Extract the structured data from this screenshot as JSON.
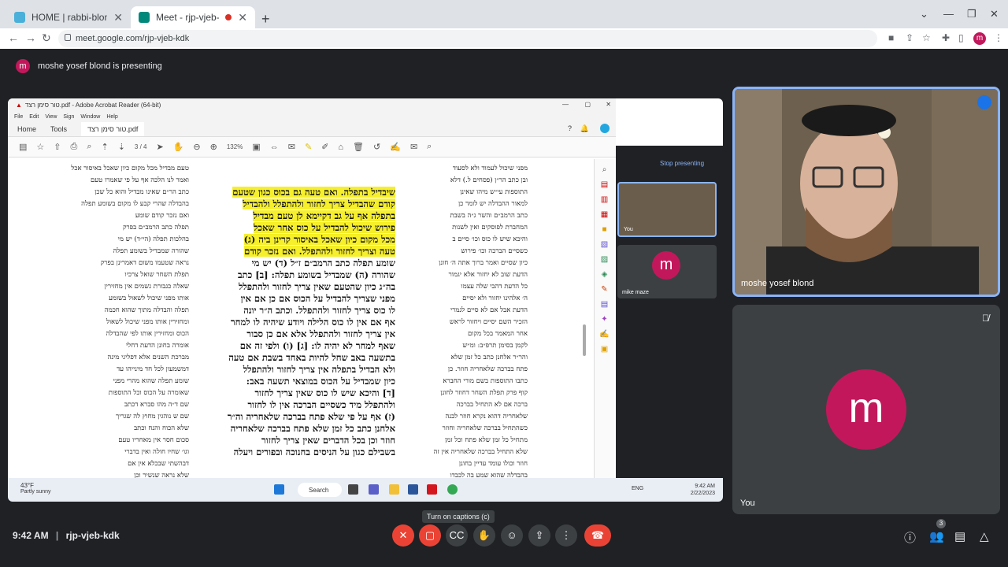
{
  "browser": {
    "tabs": [
      {
        "title": "HOME | rabbi-blond",
        "active": false
      },
      {
        "title": "Meet - rjp-vjeb-kdk",
        "active": true,
        "recording": true
      }
    ],
    "url": "meet.google.com/rjp-vjeb-kdk",
    "profile_initial": "m"
  },
  "meet": {
    "presenting_banner": "moshe yosef blond is presenting",
    "presenter_initial": "m",
    "meeting_code": "rjp-vjeb-kdk",
    "time": "9:42 AM",
    "participants_count": "3",
    "tooltip": "Turn on captions (c)",
    "tiles": [
      {
        "name": "moshe yosef blond",
        "speaking": true
      },
      {
        "name": "You",
        "initial": "m"
      }
    ],
    "colors": {
      "accent": "#8ab4f8",
      "end_call": "#ea4335",
      "avatar": "#c2185b"
    }
  },
  "shared_screen": {
    "acrobat": {
      "title": "טור סימן רצד.pdf - Adobe Acrobat Reader (64-bit)",
      "menu": [
        "File",
        "Edit",
        "View",
        "Sign",
        "Window",
        "Help"
      ],
      "tabs": [
        "Home",
        "Tools",
        "טור סימן רצד.pdf"
      ],
      "page": "3 / 4",
      "zoom": "132%"
    },
    "meet_window": {
      "stop_presenting": "Stop presenting",
      "mini_you": "You",
      "mini_participant": "mike maze",
      "mini_initial": "m"
    },
    "document": {
      "middle_column": [
        "שיבדיל בתפלה. ואם טעה גם בכוס כגון שטעם",
        "קודם שהבדיל צריך לחזור ולהתפלל ולהבדיל",
        "בתפלה אף על גב דקיימא לן טעם מבדיל",
        "פירוש שיכול להבדיל על כוס אחר שאכל",
        "מכל מקום כיון שאכל באיסור קרינן ביה (ג)",
        "טעה וצריך לחזור ולהתפלל. ואם נזכר קודם",
        "שומע תפלה כתב הרמב״ם ז״ל (ד) יש מי",
        "שהורה (ה) שמבדיל בשומע תפלה: [ב] כתב",
        "בה״ג כיון שהטעם שאין צריך לחזור ולהתפלל",
        "מפני שצריך להבדיל על הכוס אם כן אם אין",
        "לו כוס צריך לחזור ולהתפלל. וכתב ה״ר יונה",
        "אף אם אין לו כוס הלילה ויודע שיהיה לו למחר",
        "אין צריך לחזור ולהתפלל אלא אם כן סבור",
        "שאף למחר לא יהיה לו: [ג] (ו) ולפי זה אם",
        "בתשעה באב שחל להיות באחד בשבת אם טעה",
        "ולא הבדיל בתפלה אין צריך לחזור ולהתפלל",
        "כיון שמבדיל על הכוס במוצאי תשעה באב:",
        "[ד] והיכא שיש לו כוס שאין צריך לחזור",
        "ולהתפלל מיד כשסיים הברכה אין לו לחזור",
        "(ז) אף על פי שלא פתח בברכה שלאחריה וה״ר",
        "אלחנן כתב כל זמן שלא פתח בברכה שלאחריה",
        "חוזר וכן בכל הדברים שאין צריך לחזור",
        "בשבילם כגון על הניסים בחנוכה ובפורים ויעלה"
      ],
      "left_column": [
        "טעם מבדיל מכל מקום כיון שאכל באיסור אכל",
        "ואמר לנו הלכה אף על פי שאמרו טעם",
        "כתב הר״ם שאינו מבדיל והוא כל שכן",
        "בהבדלה שהרי קבע לו מקום בשומע תפלה",
        "ואם נזכר קודם שומע",
        "תפלה כתב הרמב״ם בפרק",
        "בהלכות תפלה (הי״ד) יש מי",
        "שהורה שמבדיל בשומע תפלה",
        "נראה שטעמו משום דאמרינן בפרק",
        "תפלת השחר שואל צרכיו",
        "שאלה כגבורת גשמים אין מחזירין",
        "אותו מפני שיכול לשאול בשומע",
        "תפלה והבדלה מתוך שהוא חכמה",
        "ומחזירין אותו מפני שיכול לשאול",
        "הכוס ומחזירין אותו לפי שהבדלה",
        "אומרה בחונן הדעת דחלי",
        "מברכת השנים אלא דפליגי מינה",
        "דמשמעון לכל חד מינייהו עד",
        "שומע תפלה שהוא מהרי מפני",
        "שאומרה על הכוס וכל התוספות",
        "שם ד״ה מהו סברא דכתב",
        "שם ש נוהגין מחוץ לה שגריך",
        "שלא הכוח והנח וכתב",
        "סכום חסר אין מאחריו טעם",
        "וגו׳ שחיו חולה ואין בדברי",
        "דבהשתי שבכלא אין אם",
        "שלא נראה שנשיר וכן"
      ],
      "right_column": [
        "מפני שיכול לעמוד ולא לסעוד",
        "ובן כתב הר״ן (פסחים ל.) דלא",
        "התוספות עי״ש מיהו שאינן",
        "למאור ההבדלה יש לומר כן",
        "כתב הרמב״ם והשר ג״ה בשבת",
        "המחברת לפוסקים ואין לשנות",
        "והיכא שיש לו כוס וכו׳ סיים ב",
        "כשסיים הברכה וכו׳ פירוש",
        "כיון שסיים ואמר ברוך אתה ה׳ חונן",
        "הדעת שוב לא יחזור אלא יגמור",
        "כל הדעת דהבי שלה עצמו",
        "ה׳ אלהינו יחזור ולא יסיים",
        "הדעת אבל אם לא סיים לגמרי",
        "הזכיר השם יסיים ויחזור לראש",
        "אחר המאמר בכל מקום",
        "לקמן בסימן תרפ״ב: ומ״ש",
        "והר״ר אלחנן כתב כל זמן שלא",
        "פתח בברכה שלאחריה חוזר. כן",
        "כתבו התוספות בשם מורי החברא",
        "קוף פרק תפלת השחר דחוזר לחונן",
        "ברכה אם לא התחיל בברכה",
        "שלאחריה דהוא נקרא חוזר לבנה",
        "כשהתחיל בברכה שלאחריה וחוזר",
        "מתחיל כל זמן שלא פתח וכל זמן",
        "שלא התחיל בברכה שלאחריה אין זה",
        "חוזר וכולו עומד עדיין בחונן",
        "בהבדלה שהוא שמע בה לכבדו"
      ]
    },
    "taskbar": {
      "weather_temp": "43°F",
      "weather_desc": "Partly sunny",
      "search_label": "Search",
      "lang": "ENG",
      "time": "9:42 AM",
      "date": "2/22/2023"
    }
  },
  "icons": {
    "mic": "mic-off-icon",
    "camera": "camera-off-icon",
    "captions": "captions-icon",
    "hand": "raise-hand-icon",
    "emoji": "emoji-icon",
    "present": "present-icon",
    "more": "more-icon",
    "end": "end-call-icon",
    "info": "info-icon",
    "people": "people-icon",
    "chat": "chat-icon",
    "activities": "activities-icon"
  }
}
